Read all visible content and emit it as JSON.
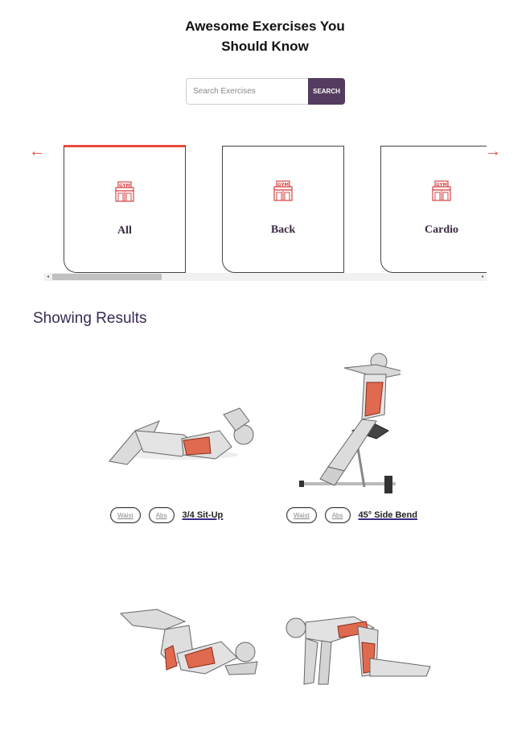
{
  "header": {
    "title_line1": "Awesome Exercises You",
    "title_line2": "Should Know"
  },
  "search": {
    "placeholder": "Search Exercises",
    "button_label": "SEARCH"
  },
  "carousel": {
    "left_arrow": "←",
    "right_arrow": "→",
    "icon": "gym-icon",
    "items": [
      {
        "label": "All",
        "active": true
      },
      {
        "label": "Back",
        "active": false
      },
      {
        "label": "Cardio",
        "active": false
      }
    ]
  },
  "results": {
    "heading": "Showing Results",
    "exercises": [
      {
        "name": "3/4 Sit-Up",
        "tags": [
          "Waist",
          "Abs"
        ],
        "image": "sit-up-illustration"
      },
      {
        "name": "45° Side Bend",
        "tags": [
          "Waist",
          "Abs"
        ],
        "image": "side-bend-illustration"
      },
      {
        "name": "",
        "tags": [],
        "image": "crunch-illustration"
      },
      {
        "name": "",
        "tags": [],
        "image": "kneeling-illustration"
      }
    ]
  },
  "colors": {
    "accent": "#e74c3c",
    "button": "#533c5f",
    "heading": "#3a2a54"
  }
}
